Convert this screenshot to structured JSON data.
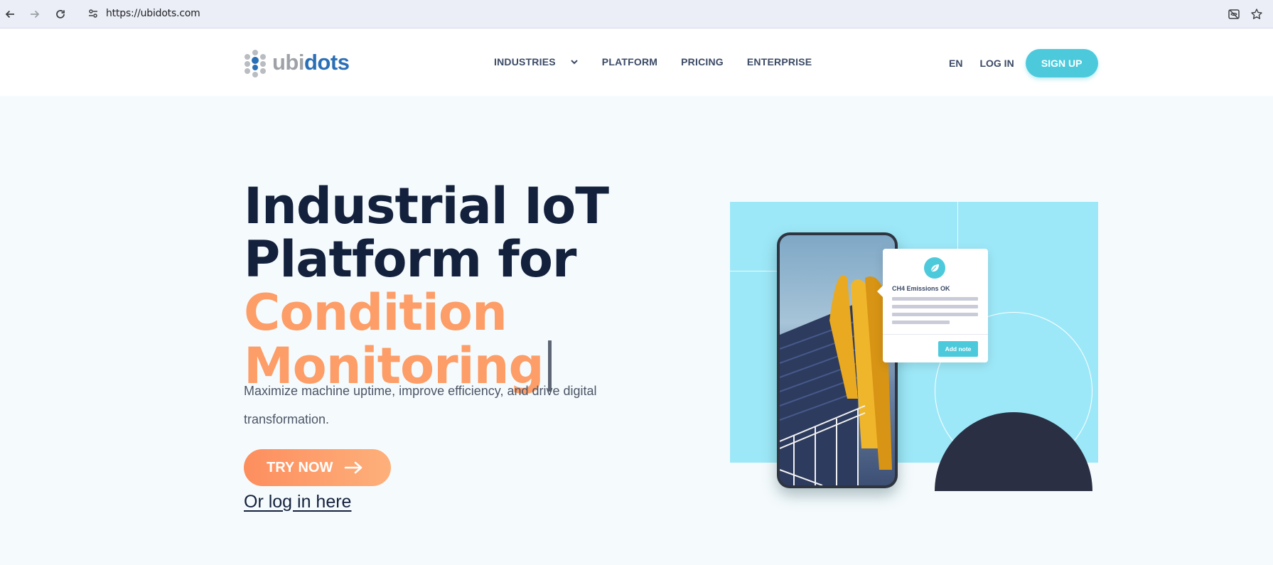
{
  "browser": {
    "url": "https://ubidots.com"
  },
  "header": {
    "logo": {
      "part1": "ubi",
      "part2": "dots"
    },
    "nav": [
      {
        "label": "INDUSTRIES"
      },
      {
        "label": "PLATFORM"
      },
      {
        "label": "PRICING"
      },
      {
        "label": "ENTERPRISE"
      }
    ],
    "lang": "EN",
    "login": "LOG IN",
    "signup": "SIGN UP"
  },
  "hero": {
    "title_line1": "Industrial IoT",
    "title_line2": "Platform for",
    "title_accent_line1": "Condition",
    "title_accent_line2": "Monitoring",
    "subtitle": "Maximize machine uptime, improve efficiency, and drive digital transformation.",
    "cta": "TRY NOW",
    "login_link": "Or log in here"
  },
  "illustration": {
    "notification_title": "CH4 Emissions OK",
    "notification_button": "Add note"
  },
  "colors": {
    "accent_orange": "#fd9d67",
    "brand_cyan": "#4ccadc",
    "navy": "#14213d",
    "logo_blue": "#2a6fb6"
  },
  "icons": [
    "back-icon",
    "forward-icon",
    "reload-icon",
    "site-settings-icon",
    "eye-off-icon",
    "bookmark-star-icon",
    "chevron-down-icon",
    "arrow-right-icon",
    "leaf-icon"
  ]
}
